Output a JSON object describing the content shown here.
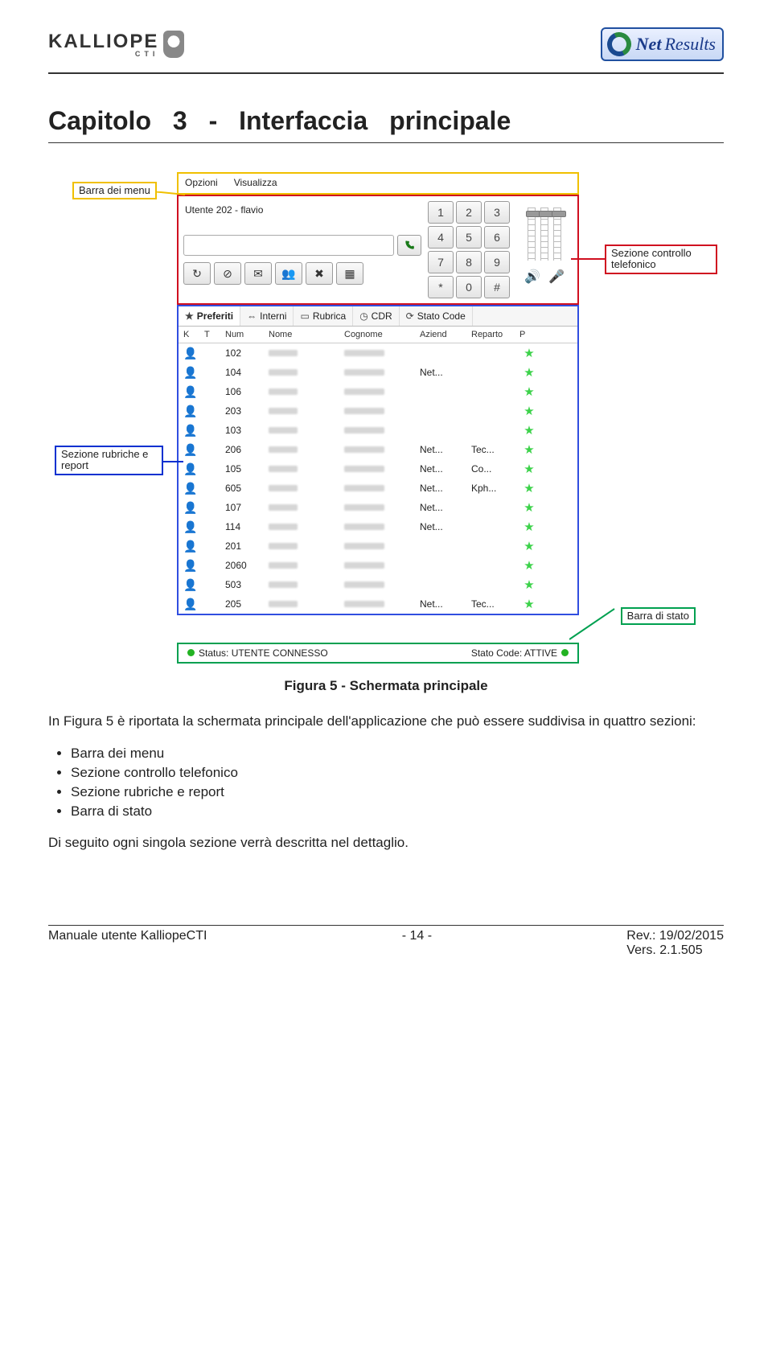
{
  "logos": {
    "kalliope_brand": "KALLIOPE",
    "kalliope_sub": "CTI",
    "netresults_a": "Net",
    "netresults_b": "Results"
  },
  "chapter_title": "Capitolo 3 -   Interfaccia principale",
  "callouts": {
    "menu": "Barra dei menu",
    "rubriche": "Sezione rubriche e report",
    "telefonico": "Sezione controllo telefonico",
    "status": "Barra di stato"
  },
  "app": {
    "menus": [
      "Opzioni",
      "Visualizza"
    ],
    "user_line": "Utente 202 - flavio",
    "search_placeholder": "",
    "keypad": [
      "1",
      "2",
      "3",
      "4",
      "5",
      "6",
      "7",
      "8",
      "9",
      "*",
      "0",
      "#"
    ],
    "toolbar_icons": [
      "redo-icon",
      "dnd-icon",
      "mail-icon",
      "contacts-icon",
      "mute-icon",
      "grid-icon"
    ],
    "tabs": [
      {
        "icon": "★",
        "label": "Preferiti",
        "selected": true
      },
      {
        "icon": "⇔",
        "label": "Interni"
      },
      {
        "icon": "▭",
        "label": "Rubrica"
      },
      {
        "icon": "◷",
        "label": "CDR"
      },
      {
        "icon": "⟳",
        "label": "Stato Code"
      }
    ],
    "columns": [
      "K",
      "T",
      "Num",
      "Nome",
      "Cognome",
      "Aziend",
      "Reparto",
      "P"
    ],
    "rows": [
      {
        "on": true,
        "dot": "green",
        "num": "102",
        "az": "",
        "rep": ""
      },
      {
        "on": true,
        "dot": "green",
        "num": "104",
        "az": "Net...",
        "rep": ""
      },
      {
        "on": true,
        "dot": "green",
        "num": "106",
        "az": "",
        "rep": ""
      },
      {
        "on": true,
        "dot": "green",
        "num": "203",
        "az": "",
        "rep": ""
      },
      {
        "on": true,
        "dot": "green",
        "num": "103",
        "az": "",
        "rep": ""
      },
      {
        "on": true,
        "dot": "red",
        "num": "206",
        "az": "Net...",
        "rep": "Tec..."
      },
      {
        "on": false,
        "dot": "grey",
        "num": "105",
        "az": "Net...",
        "rep": "Co..."
      },
      {
        "on": false,
        "dot": "grey",
        "num": "605",
        "az": "Net...",
        "rep": "Kph..."
      },
      {
        "on": false,
        "dot": "grey",
        "num": "107",
        "az": "Net...",
        "rep": ""
      },
      {
        "on": false,
        "dot": "grey",
        "num": "114",
        "az": "Net...",
        "rep": ""
      },
      {
        "on": true,
        "dot": "green",
        "num": "201",
        "az": "",
        "rep": ""
      },
      {
        "on": true,
        "dot": "green",
        "num": "2060",
        "az": "",
        "rep": ""
      },
      {
        "on": true,
        "dot": "green",
        "num": "503",
        "az": "",
        "rep": ""
      },
      {
        "on": true,
        "dot": "green",
        "num": "205",
        "az": "Net...",
        "rep": "Tec..."
      }
    ],
    "status_left": "Status: UTENTE CONNESSO",
    "status_right": "Stato Code: ATTIVE"
  },
  "caption": "Figura 5 - Schermata principale",
  "para_intro": "In Figura 5 è riportata la schermata principale dell'applicazione che può essere suddivisa in quattro sezioni:",
  "bullets": [
    "Barra dei menu",
    "Sezione controllo telefonico",
    "Sezione rubriche e report",
    "Barra di stato"
  ],
  "para_outro": "Di seguito ogni singola sezione verrà descritta nel dettaglio.",
  "footer": {
    "left": "Manuale utente KalliopeCTI",
    "center": "- 14 -",
    "rev": "Rev.: 19/02/2015",
    "vers": "Vers. 2.1.505"
  }
}
